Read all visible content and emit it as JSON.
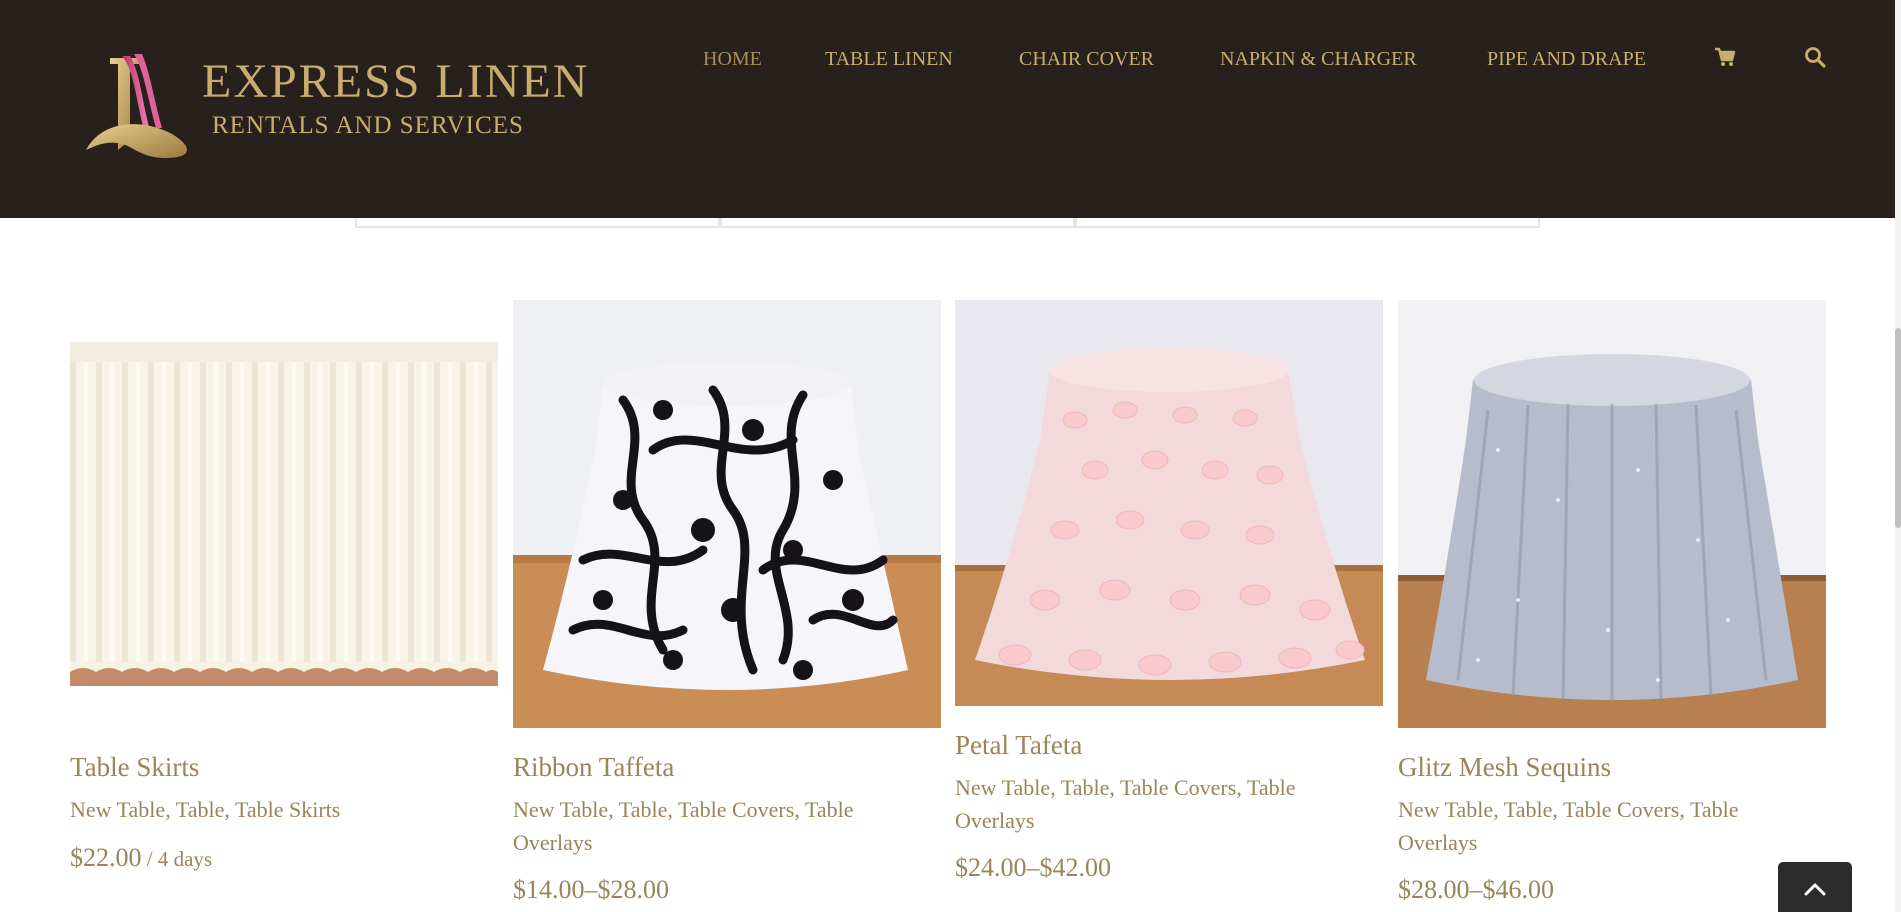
{
  "brand": {
    "name_line1": "EXPRESS LINEN",
    "name_line2": "RENTALS AND SERVICES"
  },
  "nav": {
    "items": [
      {
        "label": "HOME",
        "active": true
      },
      {
        "label": "TABLE LINEN",
        "active": false
      },
      {
        "label": "CHAIR COVER",
        "active": false
      },
      {
        "label": "NAPKIN & CHARGER",
        "active": false
      },
      {
        "label": "PIPE AND DRAPE",
        "active": false
      }
    ],
    "icons": [
      "cart-icon",
      "search-icon"
    ]
  },
  "colors": {
    "header_bg": "#28201c",
    "gold": "#c9ad6e",
    "text_gold": "#9c8459"
  },
  "products": [
    {
      "title": "Table Skirts",
      "categories": [
        "New Table",
        "Table",
        "Table Skirts"
      ],
      "price": "$22.00",
      "price_unit": " / 4 days"
    },
    {
      "title": "Ribbon Taffeta",
      "categories": [
        "New Table",
        "Table",
        "Table Covers",
        "Table Overlays"
      ],
      "price": "$14.00–$28.00",
      "price_unit": ""
    },
    {
      "title": "Petal Tafeta",
      "categories": [
        "New Table",
        "Table",
        "Table Covers",
        "Table Overlays"
      ],
      "price": "$24.00–$42.00",
      "price_unit": ""
    },
    {
      "title": "Glitz Mesh Sequins",
      "categories": [
        "New Table",
        "Table",
        "Table Covers",
        "Table Overlays"
      ],
      "price": "$28.00–$46.00",
      "price_unit": ""
    }
  ],
  "separator": ", ",
  "icons": {
    "back_to_top": "chevron-up-icon"
  }
}
